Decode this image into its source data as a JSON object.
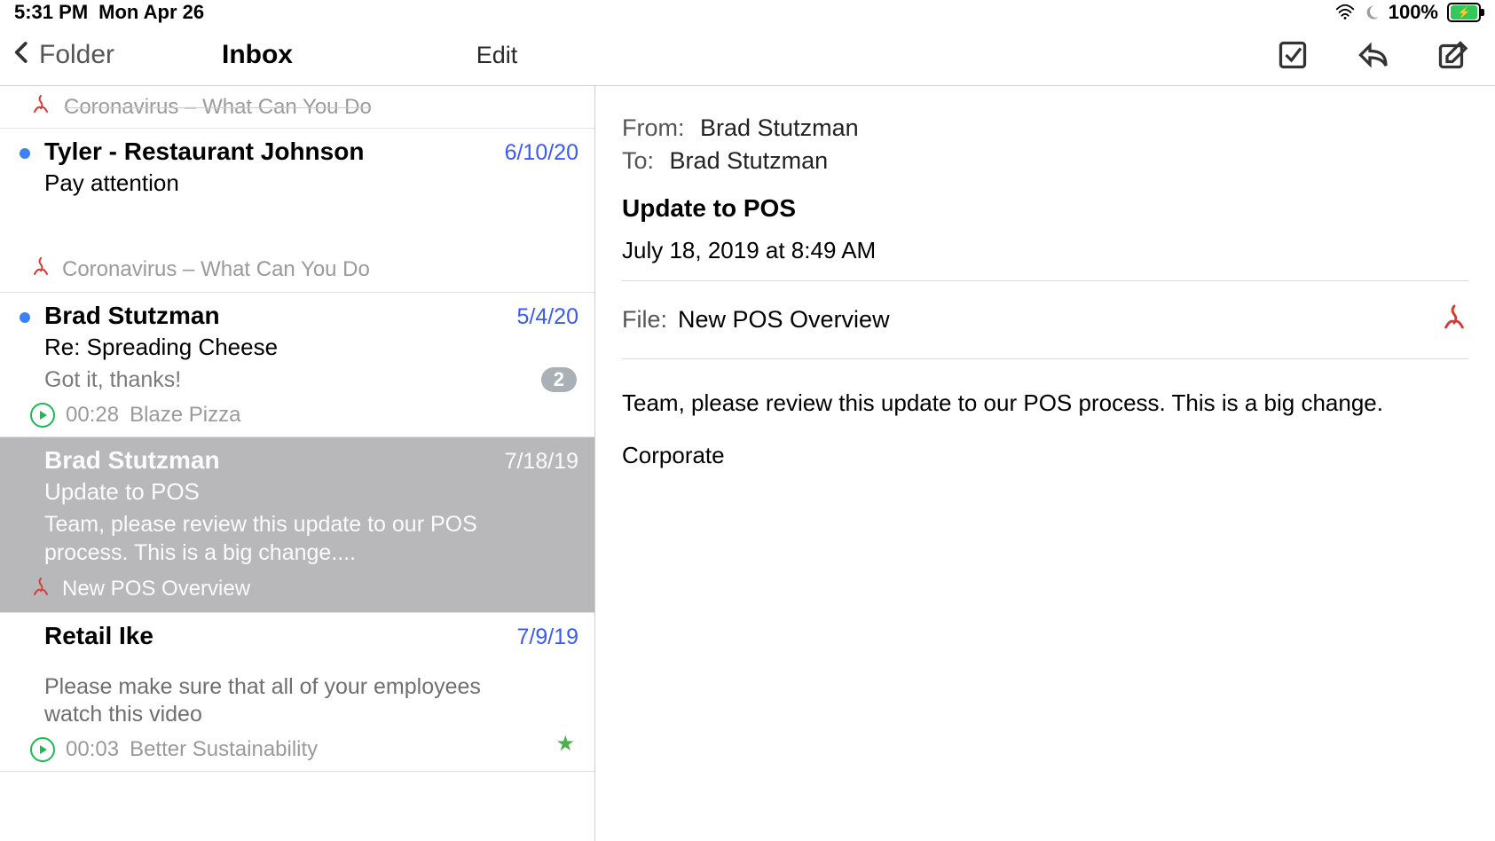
{
  "status": {
    "time": "5:31 PM",
    "date": "Mon Apr 26",
    "battery_text": "100%"
  },
  "toolbar": {
    "back_label": "Folder",
    "title": "Inbox",
    "edit_label": "Edit"
  },
  "list": {
    "cutoff_top_attachment": "Coronavirus – What Can You Do",
    "items": [
      {
        "unread": true,
        "sender": "Tyler - Restaurant Johnson",
        "date": "6/10/20",
        "subject": "Pay attention",
        "preview": "",
        "attachment_type": "pdf",
        "attachment_label": "Coronavirus – What Can You Do"
      },
      {
        "unread": true,
        "sender": "Brad Stutzman",
        "date": "5/4/20",
        "subject": "Re: Spreading Cheese",
        "preview": "Got it, thanks!",
        "thread_count": "2",
        "attachment_type": "audio",
        "attachment_duration": "00:28",
        "attachment_label": "Blaze Pizza"
      },
      {
        "selected": true,
        "sender": "Brad Stutzman",
        "date": "7/18/19",
        "subject": "Update to POS",
        "preview": "Team, please review this update to our POS process. This is a big change....",
        "attachment_type": "pdf",
        "attachment_label": "New POS Overview"
      },
      {
        "sender": "Retail Ike",
        "date": "7/9/19",
        "subject": "",
        "preview": "Please make sure that all of your employees watch this video",
        "starred": true,
        "attachment_type": "audio",
        "attachment_duration": "00:03",
        "attachment_label": "Better Sustainability"
      }
    ]
  },
  "detail": {
    "from_label": "From:",
    "from_value": "Brad Stutzman",
    "to_label": "To:",
    "to_value": "Brad Stutzman",
    "subject": "Update to POS",
    "datetime": "July 18, 2019 at 8:49 AM",
    "file_label": "File:",
    "file_name": "New POS Overview",
    "body_line1": "Team, please review this update to our POS process. This is a big change.",
    "body_line2": "Corporate"
  }
}
